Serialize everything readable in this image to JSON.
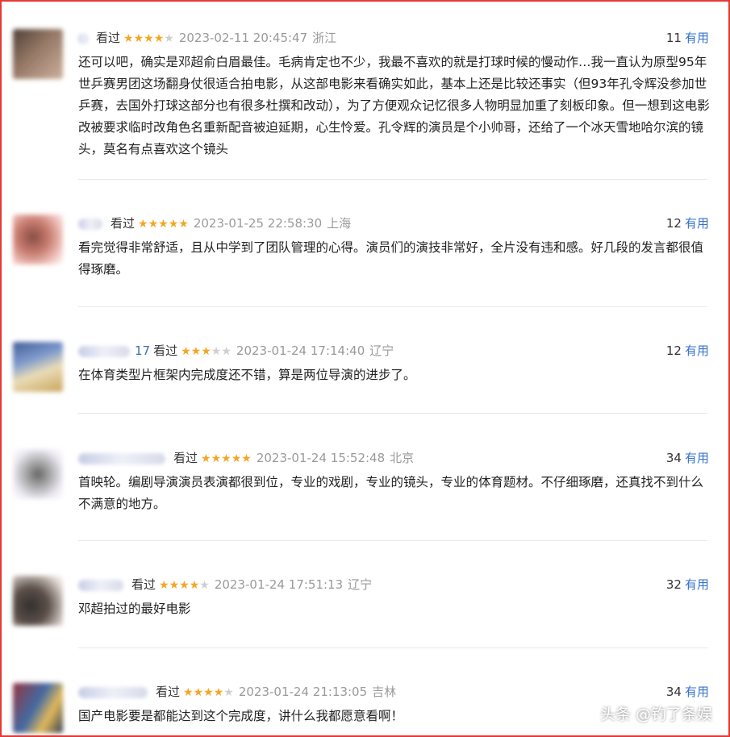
{
  "reviews": [
    {
      "user_tail": "",
      "status": "看过",
      "rating": 4,
      "time": "2023-02-11 20:45:47",
      "location": "浙江",
      "useful_count": "11",
      "useful_label": "有用",
      "text": "还可以吧，确实是邓超俞白眉最佳。毛病肯定也不少，我最不喜欢的就是打球时候的慢动作…我一直认为原型95年世乒赛男团这场翻身仗很适合拍电影，从这部电影来看确实如此，基本上还是比较还事实（但93年孔令辉没参加世乒赛，去国外打球这部分也有很多杜撰和改动），为了方便观众记忆很多人物明显加重了刻板印象。但一想到这电影改被要求临时改角色名重新配音被迫延期，心生怜爱。孔令辉的演员是个小帅哥，还给了一个冰天雪地哈尔滨的镜头，莫名有点喜欢这个镜头"
    },
    {
      "user_tail": "",
      "status": "看过",
      "rating": 5,
      "time": "2023-01-25 22:58:30",
      "location": "上海",
      "useful_count": "12",
      "useful_label": "有用",
      "text": "看完觉得非常舒适，且从中学到了团队管理的心得。演员们的演技非常好，全片没有违和感。好几段的发言都很值得琢磨。"
    },
    {
      "user_tail": "17",
      "status": "看过",
      "rating": 3,
      "time": "2023-01-24 17:14:40",
      "location": "辽宁",
      "useful_count": "12",
      "useful_label": "有用",
      "text": "在体育类型片框架内完成度还不错，算是两位导演的进步了。"
    },
    {
      "user_tail": "",
      "status": "看过",
      "rating": 5,
      "time": "2023-01-24 15:52:48",
      "location": "北京",
      "useful_count": "34",
      "useful_label": "有用",
      "text": "首映轮。编剧导演演员表演都很到位，专业的戏剧，专业的镜头，专业的体育题材。不仔细琢磨，还真找不到什么不满意的地方。"
    },
    {
      "user_tail": "",
      "status": "看过",
      "rating": 4,
      "time": "2023-01-24 17:51:13",
      "location": "辽宁",
      "useful_count": "32",
      "useful_label": "有用",
      "text": "邓超拍过的最好电影"
    },
    {
      "user_tail": "",
      "status": "看过",
      "rating": 4,
      "time": "2023-01-24 21:13:05",
      "location": "吉林",
      "useful_count": "34",
      "useful_label": "有用",
      "text": "国产电影要是都能达到这个完成度，讲什么我都愿意看啊！"
    }
  ],
  "star_colors": {
    "on": "#f4a623",
    "off": "#cfcfcf"
  },
  "accent_color": "#3573c9",
  "watermark": "头条 @钓了条娱"
}
